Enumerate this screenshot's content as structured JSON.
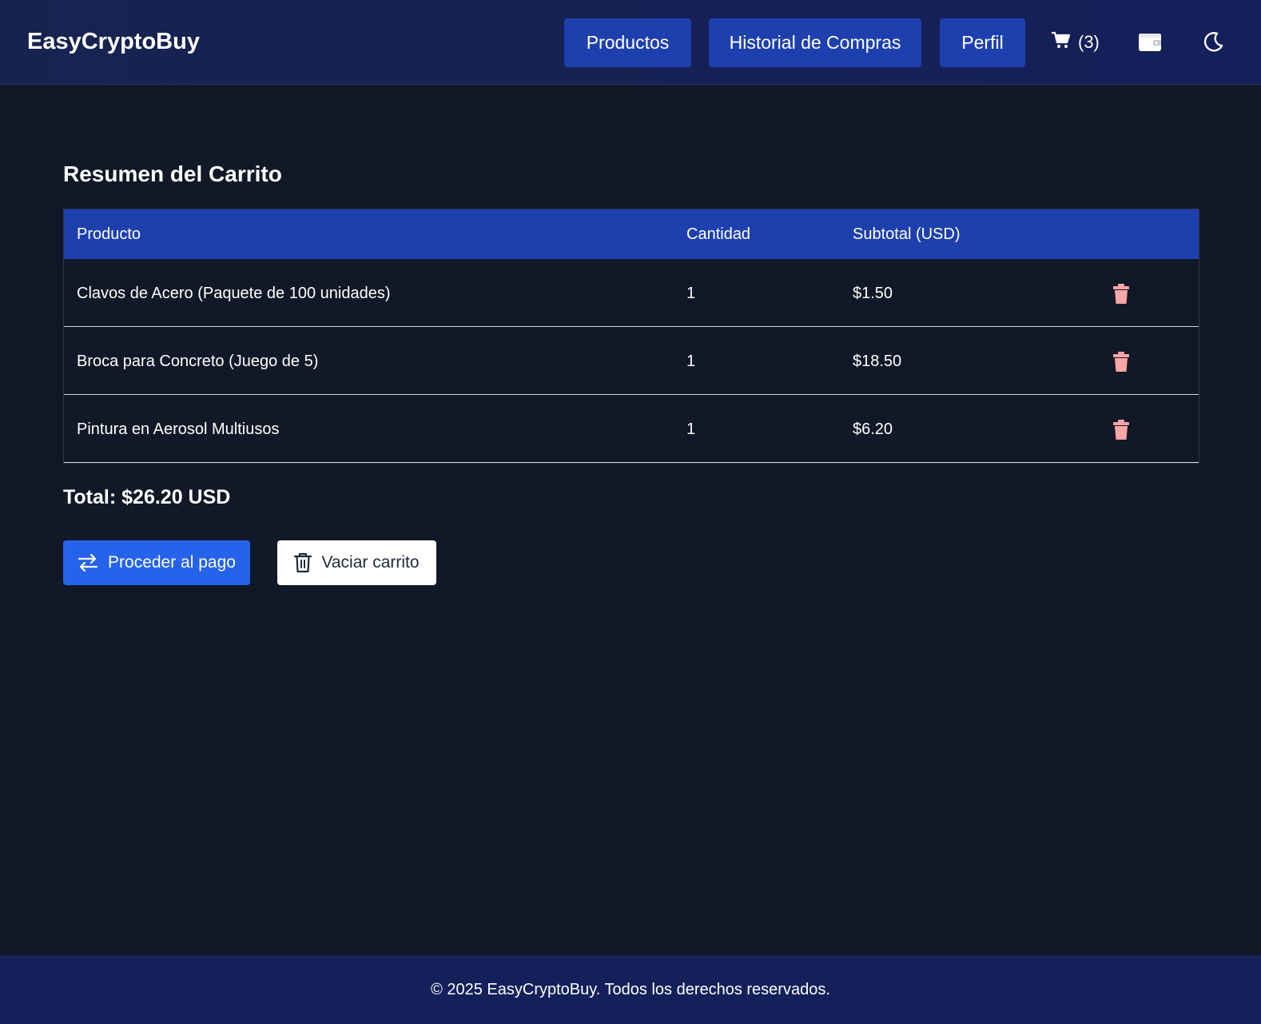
{
  "header": {
    "brand": "EasyCryptoBuy",
    "nav": {
      "products": "Productos",
      "history": "Historial de Compras",
      "profile": "Perfil"
    },
    "cart_count": "(3)",
    "icons": {
      "cart": "cart-icon",
      "wallet": "wallet-icon",
      "theme": "moon-icon"
    }
  },
  "main": {
    "title": "Resumen del Carrito",
    "table": {
      "headers": {
        "product": "Producto",
        "quantity": "Cantidad",
        "subtotal": "Subtotal (USD)"
      },
      "rows": [
        {
          "product": "Clavos de Acero (Paquete de 100 unidades)",
          "quantity": "1",
          "subtotal": "$1.50"
        },
        {
          "product": "Broca para Concreto (Juego de 5)",
          "quantity": "1",
          "subtotal": "$18.50"
        },
        {
          "product": "Pintura en Aerosol Multiusos",
          "quantity": "1",
          "subtotal": "$6.20"
        }
      ]
    },
    "total": "Total: $26.20 USD",
    "actions": {
      "pay": "Proceder al pago",
      "empty": "Vaciar carrito"
    }
  },
  "footer": {
    "text": "© 2025 EasyCryptoBuy. Todos los derechos reservados."
  },
  "colors": {
    "background": "#111827",
    "header": "#17234f",
    "primary": "#1e40af",
    "accent": "#2563eb",
    "delete": "#fca5a5"
  }
}
